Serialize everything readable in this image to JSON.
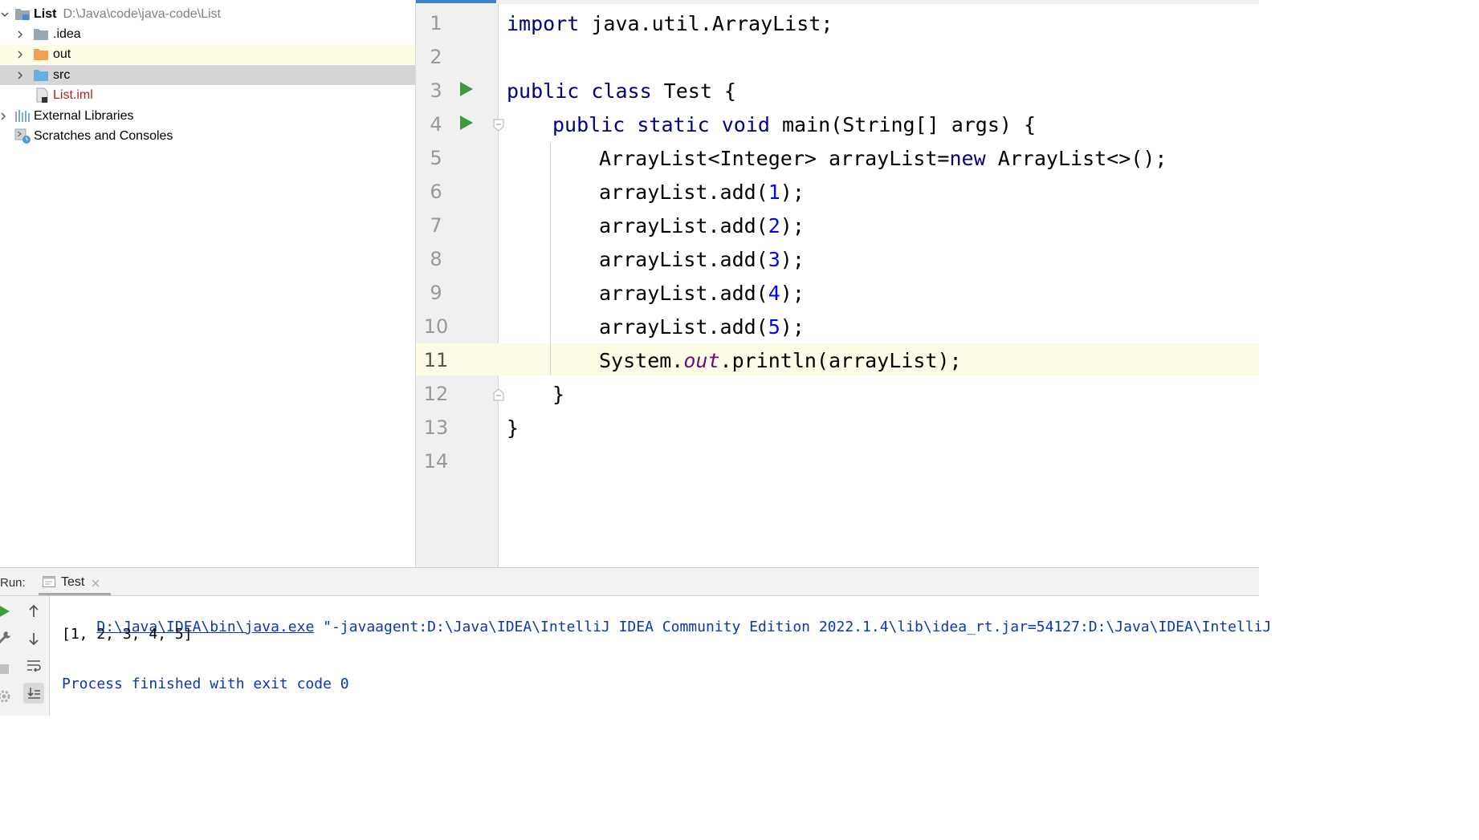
{
  "project_tree": {
    "root": {
      "label": "List",
      "path": "D:\\Java\\code\\java-code\\List"
    },
    "items": [
      {
        "label": ".idea"
      },
      {
        "label": "out"
      },
      {
        "label": "src"
      },
      {
        "label": "List.iml"
      },
      {
        "label": "External Libraries"
      },
      {
        "label": "Scratches and Consoles"
      }
    ]
  },
  "editor": {
    "line_numbers": [
      "1",
      "2",
      "3",
      "4",
      "5",
      "6",
      "7",
      "8",
      "9",
      "10",
      "11",
      "12",
      "13",
      "14"
    ],
    "current_line": "11",
    "code": {
      "l1": {
        "kw": "import",
        "rest": " java.util.ArrayList;"
      },
      "l3": {
        "kw": "public class",
        "rest": " Test {"
      },
      "l4": {
        "kw": "public static void",
        "rest": " main(String[] args) {"
      },
      "l5": {
        "a": "ArrayList<Integer> arrayList=",
        "kw": "new",
        "b": " ArrayList<>();"
      },
      "l6": {
        "a": "arrayList.add(",
        "num": "1",
        "b": ");"
      },
      "l7": {
        "a": "arrayList.add(",
        "num": "2",
        "b": ");"
      },
      "l8": {
        "a": "arrayList.add(",
        "num": "3",
        "b": ");"
      },
      "l9": {
        "a": "arrayList.add(",
        "num": "4",
        "b": ");"
      },
      "l10": {
        "a": "arrayList.add(",
        "num": "5",
        "b": ");"
      },
      "l11": {
        "a": "System.",
        "field": "out",
        "b": ".println(arrayList);"
      },
      "l12": "}",
      "l13": "}"
    }
  },
  "run_panel": {
    "label": "Run:",
    "tab_label": "Test",
    "console": {
      "java_path": "D:\\Java\\IDEA\\bin\\java.exe",
      "command_rest": " \"-javaagent:D:\\Java\\IDEA\\IntelliJ IDEA Community Edition 2022.1.4\\lib\\idea_rt.jar=54127:D:\\Java\\IDEA\\IntelliJ",
      "output": "[1, 2, 3, 4, 5]",
      "exit_message": "Process finished with exit code 0"
    }
  },
  "colors": {
    "keyword": "#000080",
    "number": "#0000ff",
    "static_field": "#660e7a",
    "run_icon": "#3e9a3e",
    "folder_orange": "#f0a050",
    "folder_blue": "#6ab0de",
    "folder_gray": "#9aa7b0",
    "current_line_bg": "#fdfbe6"
  }
}
